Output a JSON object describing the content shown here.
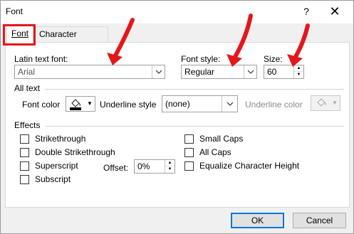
{
  "window": {
    "title": "Font",
    "help": "?",
    "close": "✕"
  },
  "tabs": [
    {
      "label": "Font",
      "accel": "n"
    },
    {
      "label": "Character Spacing",
      "accel": "r"
    }
  ],
  "latin_font": {
    "label": "Latin text font:",
    "value": "Arial"
  },
  "font_style": {
    "label": "Font style:",
    "value": "Regular"
  },
  "size": {
    "label": "Size:",
    "value": "60"
  },
  "all_text": {
    "header": "All text",
    "font_color_label": "Font color",
    "underline_style_label": "Underline style",
    "underline_style_value": "(none)",
    "underline_color_label": "Underline color"
  },
  "effects": {
    "header": "Effects",
    "strikethrough": "Strikethrough",
    "double_strikethrough": "Double Strikethrough",
    "superscript": "Superscript",
    "subscript": "Subscript",
    "offset_label": "Offset:",
    "offset_value": "0%",
    "small_caps": "Small Caps",
    "all_caps": "All Caps",
    "equalize": "Equalize Character Height"
  },
  "buttons": {
    "ok": "OK",
    "cancel": "Cancel"
  },
  "colors": {
    "annotation_red": "#e5161b",
    "accent_blue": "#0078d7"
  },
  "icons": [
    "help-icon",
    "close-icon",
    "chevron-down-icon",
    "spin-up-icon",
    "spin-down-icon",
    "paint-bucket-icon",
    "red-arrow-icon"
  ]
}
